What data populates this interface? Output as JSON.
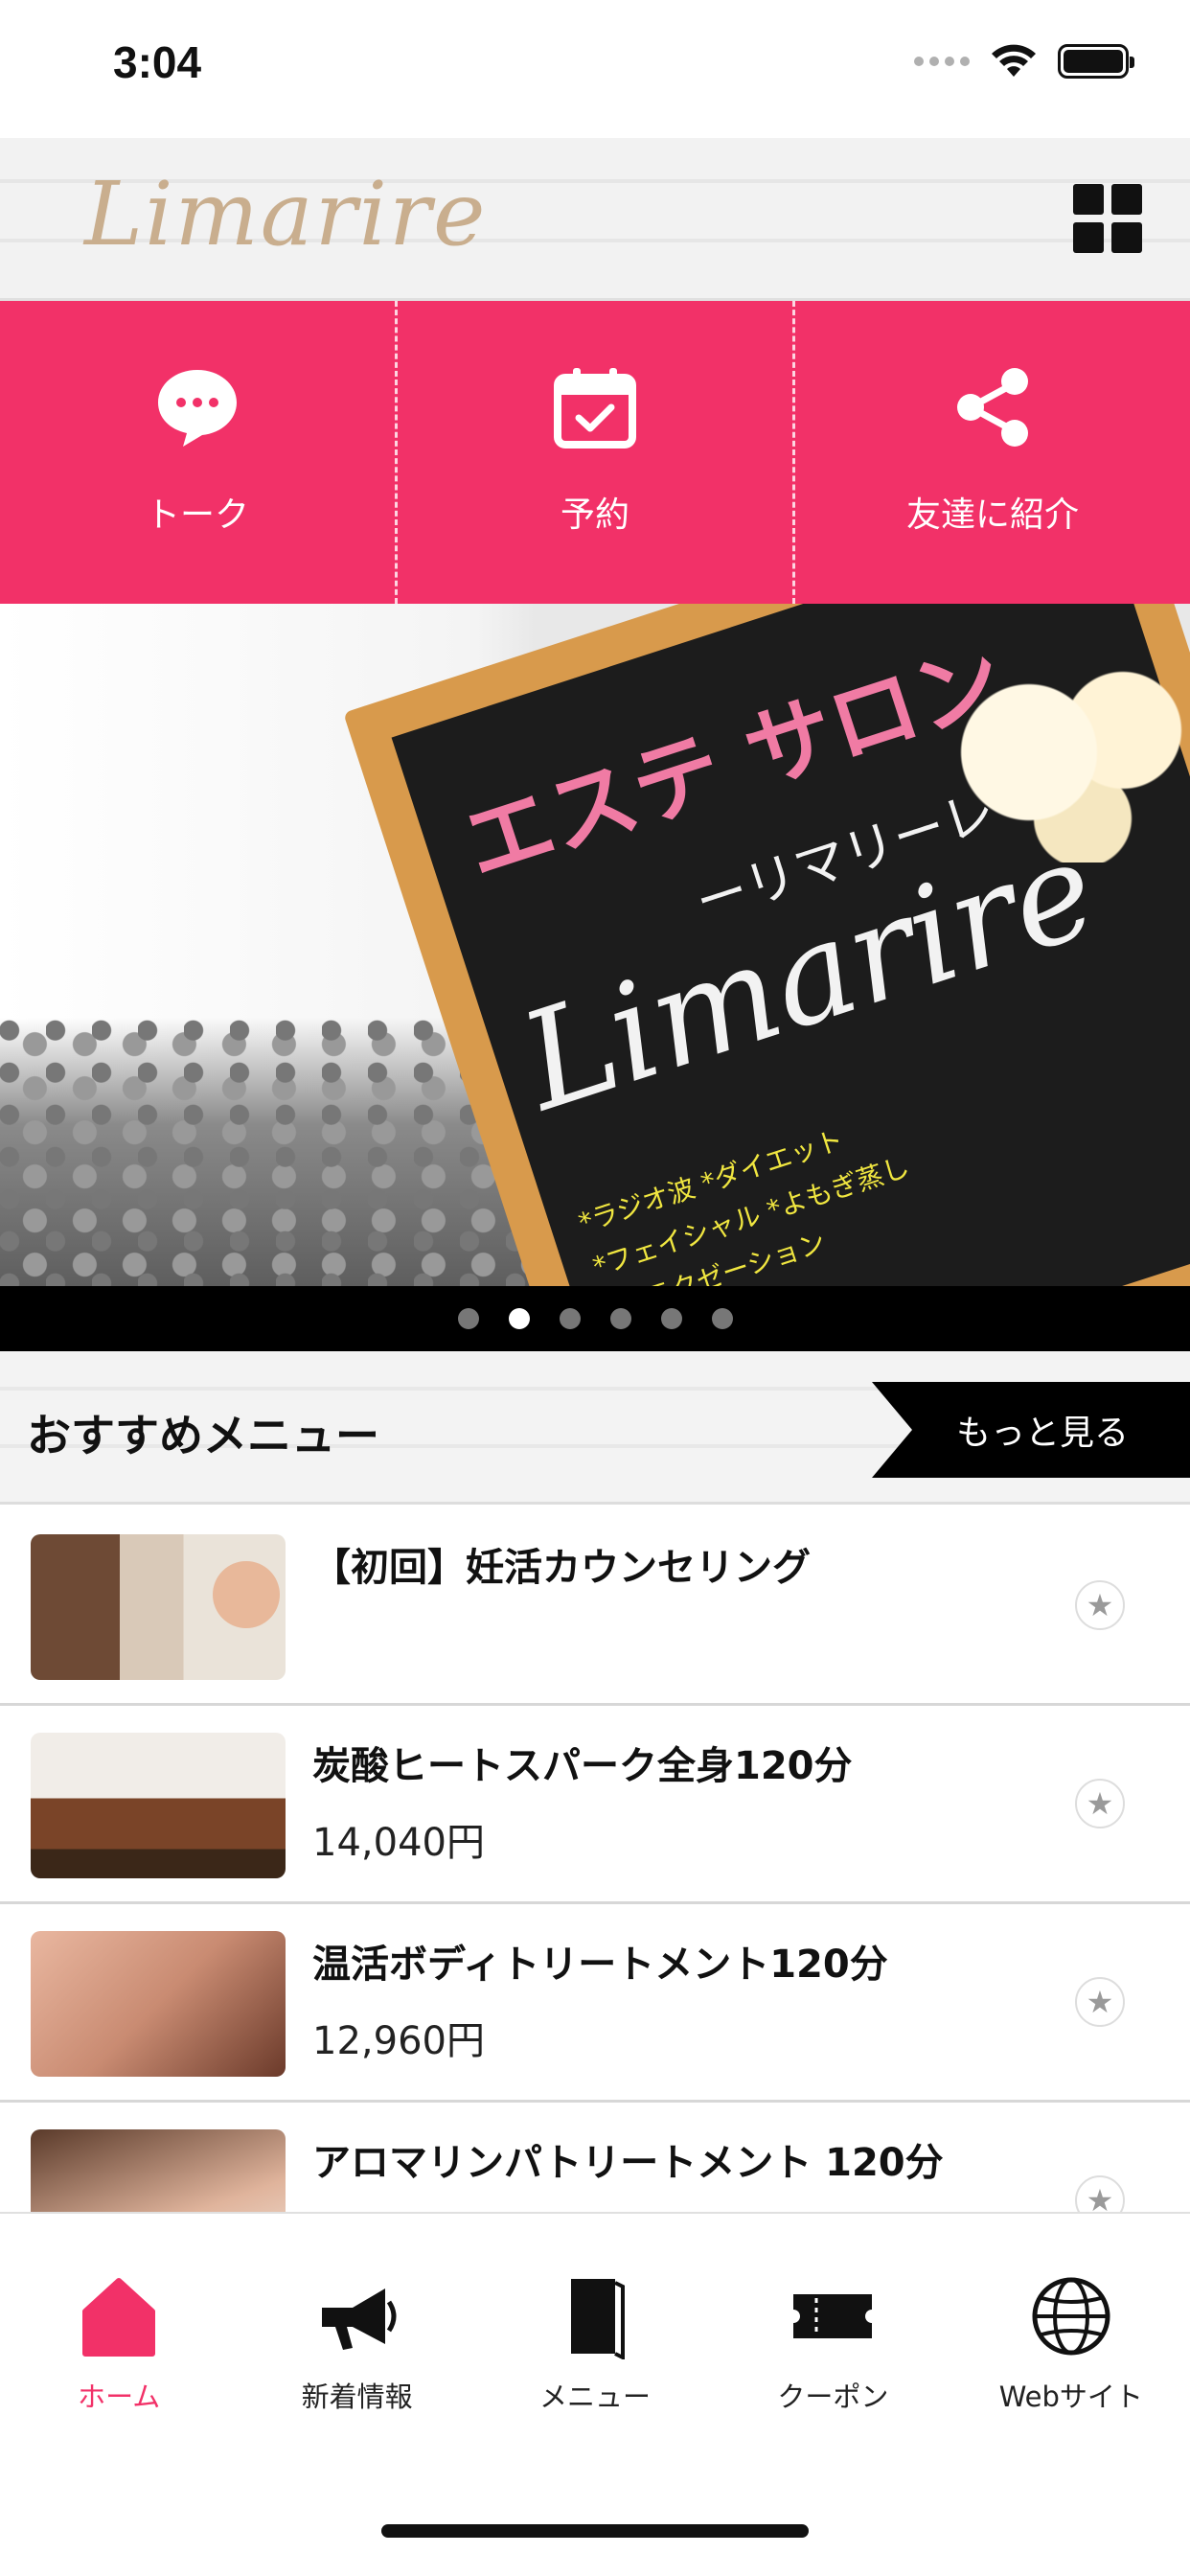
{
  "status_bar": {
    "time": "3:04"
  },
  "header": {
    "logo_text": "Limarire"
  },
  "quick_actions": [
    {
      "label": "トーク",
      "icon": "chat-bubble-icon"
    },
    {
      "label": "予約",
      "icon": "calendar-check-icon"
    },
    {
      "label": "友達に紹介",
      "icon": "share-icon"
    }
  ],
  "carousel": {
    "pink_text": "エステ サロン",
    "logo_text": "Limarire",
    "sub_text": "ーリマリーレー",
    "yellow_text": "*ラジオ波 *ダイエット\n*フェイシャル *よもぎ蒸し\n*リラクゼーション",
    "slide_count": 6,
    "active_index": 1
  },
  "section": {
    "title": "おすすめメニュー",
    "more_label": "もっと見る"
  },
  "menu_items": [
    {
      "title": "【初回】妊活カウンセリング",
      "price": ""
    },
    {
      "title": "炭酸ヒートスパーク全身120分",
      "price": "14,040円"
    },
    {
      "title": "温活ボディトリートメント120分",
      "price": "12,960円"
    },
    {
      "title": "アロマリンパトリートメント 120分",
      "price": ""
    }
  ],
  "tabs": [
    {
      "label": "ホーム",
      "icon": "home-icon",
      "active": true
    },
    {
      "label": "新着情報",
      "icon": "megaphone-icon",
      "active": false
    },
    {
      "label": "メニュー",
      "icon": "book-icon",
      "active": false
    },
    {
      "label": "クーポン",
      "icon": "ticket-icon",
      "active": false
    },
    {
      "label": "Webサイト",
      "icon": "globe-icon",
      "active": false
    }
  ],
  "colors": {
    "accent": "#f23168",
    "logo": "#c9ae8e"
  }
}
